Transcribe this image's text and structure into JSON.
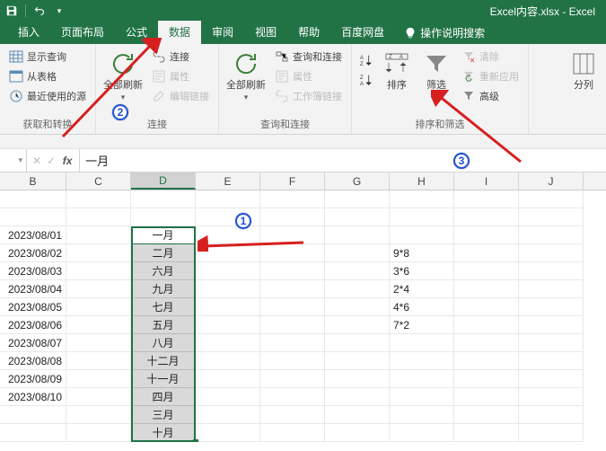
{
  "title": "Excel内容.xlsx - Excel",
  "tabs": {
    "insert": "插入",
    "page_layout": "页面布局",
    "formulas": "公式",
    "data": "数据",
    "review": "审阅",
    "view": "视图",
    "help": "帮助",
    "baidu": "百度网盘",
    "tell_me": "操作说明搜索"
  },
  "ribbon": {
    "group_get": {
      "show_queries": "显示查询",
      "from_table": "从表格",
      "recent_sources": "最近使用的源",
      "label": "获取和转换"
    },
    "group_connections": {
      "refresh_all": "全部刷新",
      "connections": "连接",
      "properties": "属性",
      "edit_links": "编辑链接",
      "label": "连接"
    },
    "group_queries": {
      "refresh_all2": "全部刷新",
      "queries_connections": "查询和连接",
      "properties2": "属性",
      "workbook_links": "工作簿链接",
      "label": "查询和连接"
    },
    "group_sort": {
      "sort_asc": "A→Z",
      "sort_desc": "Z→A",
      "sort": "排序",
      "filter": "筛选",
      "clear": "清除",
      "reapply": "重新应用",
      "advanced": "高级",
      "label": "排序和筛选"
    },
    "group_data_tools": {
      "text_to_columns": "分列"
    }
  },
  "formula_bar": {
    "name_box": "",
    "value": "一月"
  },
  "columns": [
    "B",
    "C",
    "D",
    "E",
    "F",
    "G",
    "H",
    "I",
    "J"
  ],
  "rows": [
    {
      "B": "",
      "D": "",
      "H": ""
    },
    {
      "B": "",
      "D": "",
      "H": ""
    },
    {
      "B": "2023/08/01",
      "D": "一月",
      "H": ""
    },
    {
      "B": "2023/08/02",
      "D": "二月",
      "H": "9*8"
    },
    {
      "B": "2023/08/03",
      "D": "六月",
      "H": "3*6"
    },
    {
      "B": "2023/08/04",
      "D": "九月",
      "H": "2*4"
    },
    {
      "B": "2023/08/05",
      "D": "七月",
      "H": "4*6"
    },
    {
      "B": "2023/08/06",
      "D": "五月",
      "H": "7*2"
    },
    {
      "B": "2023/08/07",
      "D": "八月",
      "H": ""
    },
    {
      "B": "2023/08/08",
      "D": "十二月",
      "H": ""
    },
    {
      "B": "2023/08/09",
      "D": "十一月",
      "H": ""
    },
    {
      "B": "2023/08/10",
      "D": "四月",
      "H": ""
    },
    {
      "B": "",
      "D": "三月",
      "H": ""
    },
    {
      "B": "",
      "D": "十月",
      "H": ""
    }
  ],
  "annotations": {
    "c1": "1",
    "c2": "2",
    "c3": "3"
  }
}
